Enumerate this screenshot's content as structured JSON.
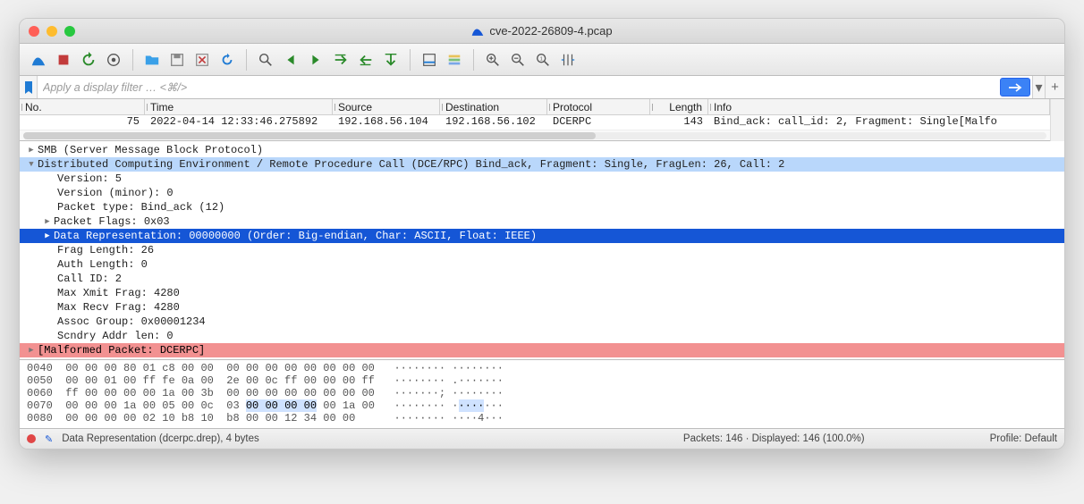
{
  "window": {
    "title": "cve-2022-26809-4.pcap"
  },
  "filter": {
    "placeholder": "Apply a display filter … <⌘/>"
  },
  "columns": {
    "no": "No.",
    "time": "Time",
    "source": "Source",
    "destination": "Destination",
    "protocol": "Protocol",
    "length": "Length",
    "info": "Info"
  },
  "packets": [
    {
      "no": "75",
      "time": "2022-04-14 12:33:46.275892",
      "source": "192.168.56.104",
      "destination": "192.168.56.102",
      "protocol": "DCERPC",
      "length": "143",
      "info": "Bind_ack: call_id: 2, Fragment: Single[Malfo"
    }
  ],
  "details": {
    "smb": "SMB (Server Message Block Protocol)",
    "dcerpc_header": "Distributed Computing Environment / Remote Procedure Call (DCE/RPC) Bind_ack, Fragment: Single, FragLen: 26, Call: 2",
    "version": "Version: 5",
    "version_minor": "Version (minor): 0",
    "packet_type": "Packet type: Bind_ack (12)",
    "packet_flags": "Packet Flags: 0x03",
    "data_rep": "Data Representation: 00000000 (Order: Big-endian, Char: ASCII, Float: IEEE)",
    "frag_len": "Frag Length: 26",
    "auth_len": "Auth Length: 0",
    "call_id": "Call ID: 2",
    "max_xmit": "Max Xmit Frag: 4280",
    "max_recv": "Max Recv Frag: 4280",
    "assoc_group": "Assoc Group: 0x00001234",
    "scndry_addr": "Scndry Addr len: 0",
    "malformed": "[Malformed Packet: DCERPC]"
  },
  "hex": {
    "l0040": {
      "off": "0040",
      "hex": "00 00 00 80 01 c8 00 00  00 00 00 00 00 00 00 00",
      "ascii": "········ ········"
    },
    "l0050": {
      "off": "0050",
      "hex": "00 00 01 00 ff fe 0a 00  2e 00 0c ff 00 00 00 ff",
      "ascii": "········ .·······"
    },
    "l0060": {
      "off": "0060",
      "hex": "ff 00 00 00 00 1a 00 3b  00 00 00 00 00 00 00 00",
      "ascii": "·······; ········"
    },
    "l0070": {
      "off": "0070",
      "hex_pre": "00 00 00 1a 00 05 00 0c  03 ",
      "hex_hl": "00 00 00 00",
      "hex_post": " 00 1a 00",
      "ascii_pre": "········ ·",
      "ascii_hl": "····",
      "ascii_post": "···"
    },
    "l0080": {
      "off": "0080",
      "hex": "00 00 00 00 02 10 b8 10  b8 00 00 12 34 00 00",
      "ascii": "········ ····4···"
    }
  },
  "status": {
    "field": "Data Representation (dcerpc.drep), 4 bytes",
    "packets": "Packets: 146 · Displayed: 146 (100.0%)",
    "profile": "Profile: Default"
  },
  "toolbar_icons": [
    "shark-fin-icon",
    "stop-icon",
    "restart-icon",
    "options-icon",
    "open-icon",
    "save-icon",
    "close-file-icon",
    "reload-icon",
    "find-icon",
    "prev-icon",
    "next-icon",
    "goto-icon",
    "first-icon",
    "last-icon",
    "auto-scroll-icon",
    "colorize-icon",
    "zoom-in-icon",
    "zoom-out-icon",
    "zoom-reset-icon",
    "resize-columns-icon"
  ]
}
